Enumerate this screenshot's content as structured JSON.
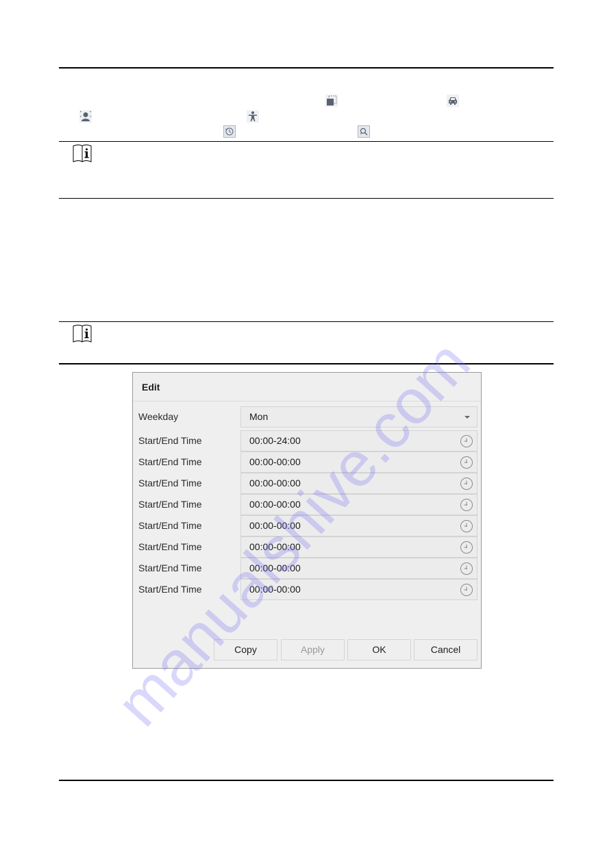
{
  "document": {
    "inline_icons": [
      {
        "name": "area-icon"
      },
      {
        "name": "vehicle-icon"
      },
      {
        "name": "face-icon"
      },
      {
        "name": "human-body-icon"
      },
      {
        "name": "playback-icon"
      },
      {
        "name": "search-icon"
      }
    ],
    "notes": [
      {
        "icon": "note-info-icon"
      },
      {
        "icon": "note-info-icon"
      }
    ]
  },
  "dialog": {
    "title": "Edit",
    "weekday": {
      "label": "Weekday",
      "value": "Mon"
    },
    "time_rows": [
      {
        "label": "Start/End Time",
        "value": "00:00-24:00"
      },
      {
        "label": "Start/End Time",
        "value": "00:00-00:00"
      },
      {
        "label": "Start/End Time",
        "value": "00:00-00:00"
      },
      {
        "label": "Start/End Time",
        "value": "00:00-00:00"
      },
      {
        "label": "Start/End Time",
        "value": "00:00-00:00"
      },
      {
        "label": "Start/End Time",
        "value": "00:00-00:00"
      },
      {
        "label": "Start/End Time",
        "value": "00:00-00:00"
      },
      {
        "label": "Start/End Time",
        "value": "00:00-00:00"
      }
    ],
    "buttons": {
      "copy": "Copy",
      "apply": "Apply",
      "ok": "OK",
      "cancel": "Cancel"
    }
  },
  "watermark": "manualshive.com"
}
